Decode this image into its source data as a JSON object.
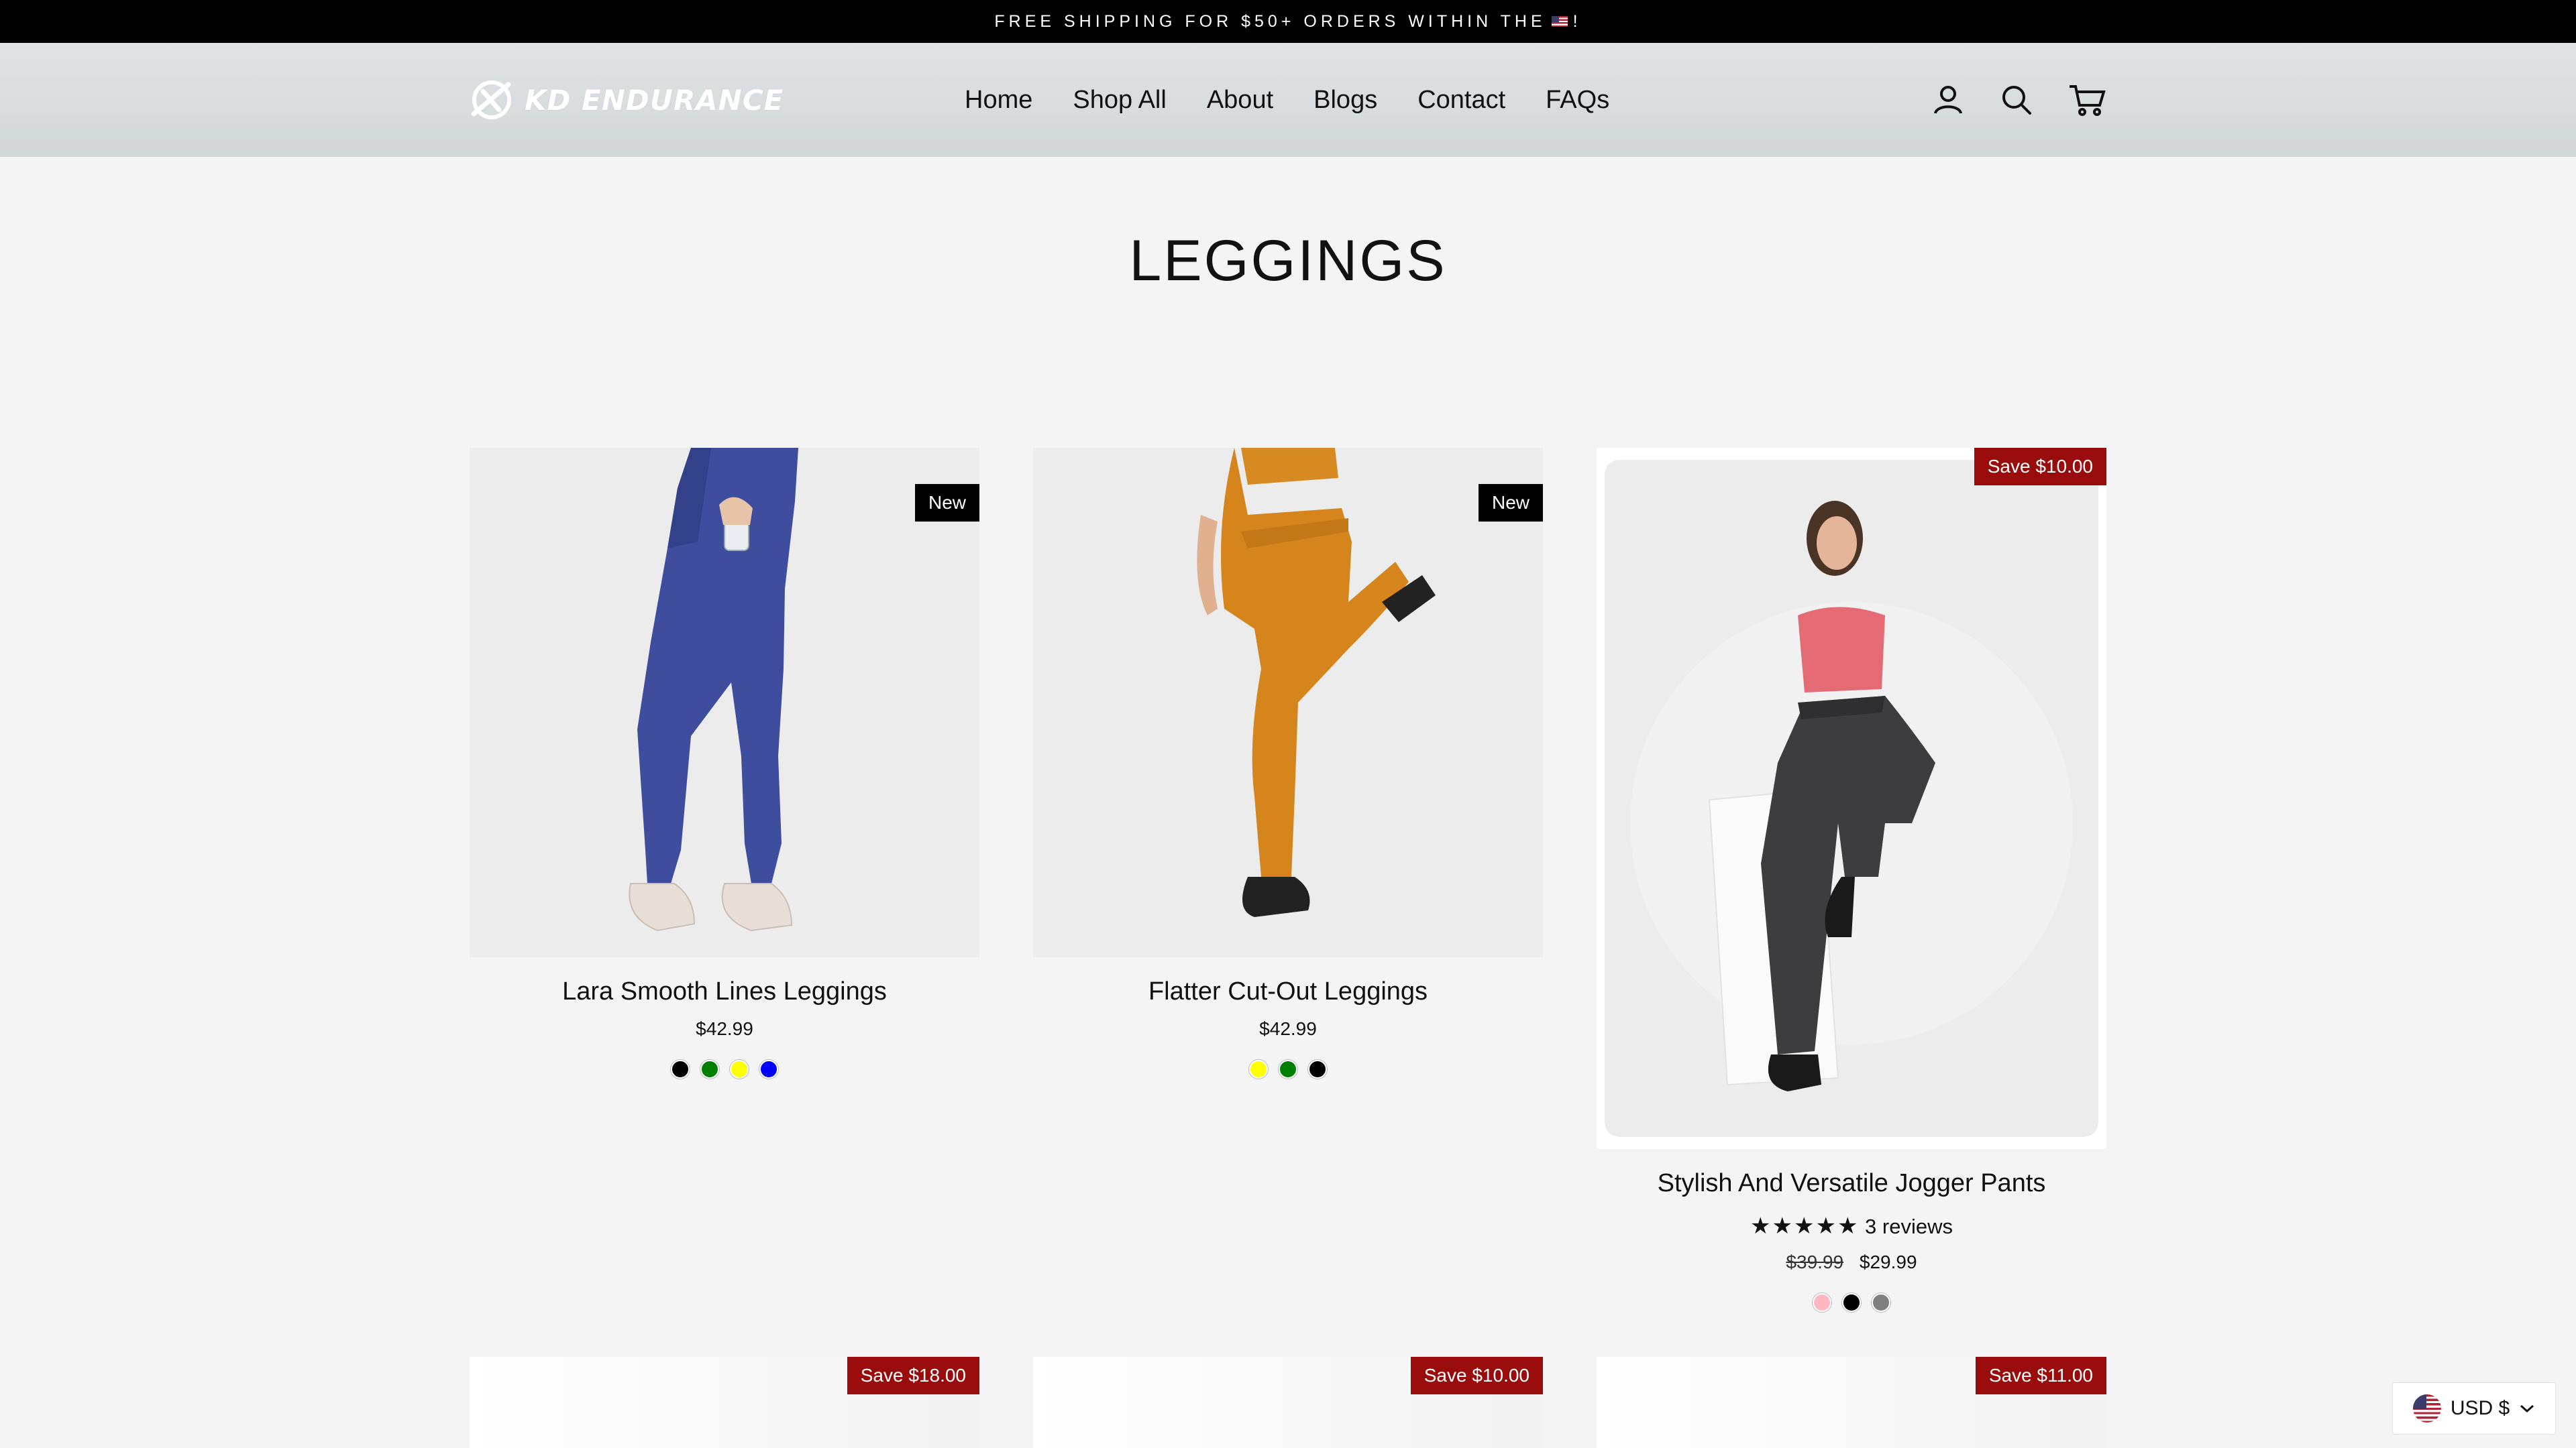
{
  "announcement": {
    "text_before_flag": "FREE SHIPPING FOR $50+ ORDERS WITHIN THE",
    "text_after_flag": "!"
  },
  "header": {
    "logo_text": "KD ENDURANCE",
    "nav": [
      "Home",
      "Shop All",
      "About",
      "Blogs",
      "Contact",
      "FAQs"
    ],
    "icons": [
      "account-icon",
      "search-icon",
      "cart-icon"
    ]
  },
  "page": {
    "title": "LEGGINGS"
  },
  "products": [
    {
      "name": "Lara Smooth Lines Leggings",
      "price": "$42.99",
      "badge": "New",
      "swatches": [
        "#000000",
        "#008000",
        "#ffff00",
        "#0000ff"
      ]
    },
    {
      "name": "Flatter Cut-Out Leggings",
      "price": "$42.99",
      "badge": "New",
      "swatches": [
        "#ffff00",
        "#008000",
        "#000000"
      ]
    },
    {
      "name": "Stylish And Versatile Jogger Pants",
      "old_price": "$39.99",
      "price": "$29.99",
      "badge": "Save $10.00",
      "stars": "★★★★★",
      "reviews": "3 reviews",
      "swatches": [
        "#ffb6c1",
        "#000000",
        "#808080"
      ]
    },
    {
      "badge": "Save $18.00"
    },
    {
      "badge": "Save $10.00"
    },
    {
      "badge": "Save $11.00"
    }
  ],
  "currency": {
    "label": "USD $"
  },
  "colors": {
    "save_badge": "#9a0c0c",
    "announcement_bg": "#000000",
    "header_bg": "#d8dcdf"
  }
}
